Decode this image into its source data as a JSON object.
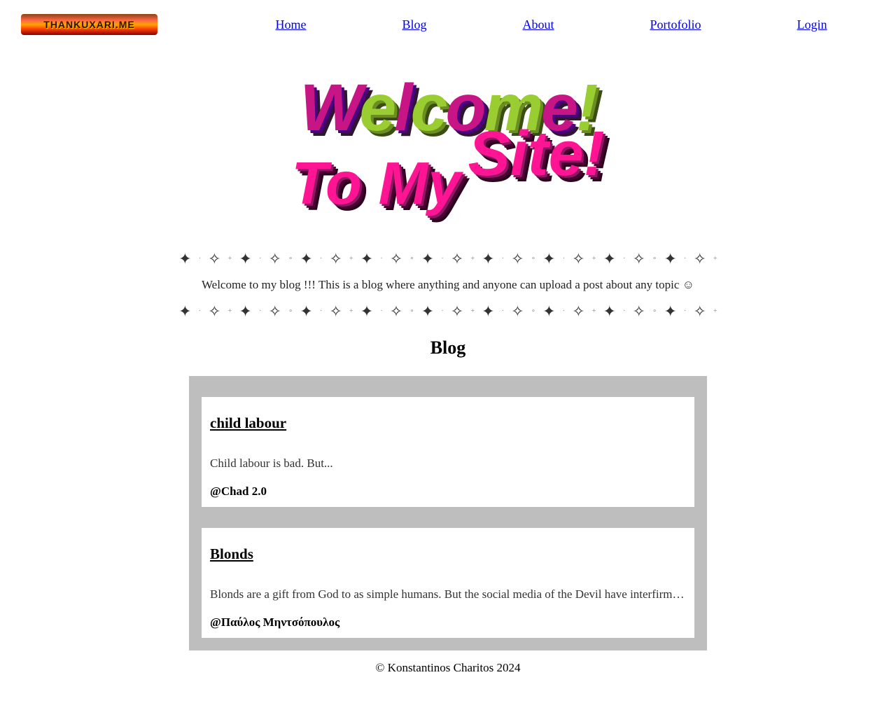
{
  "logo_text": "THANKUXARI.ME",
  "nav": {
    "home": "Home",
    "blog": "Blog",
    "about": "About",
    "portfolio": "Portofolio",
    "login": "Login"
  },
  "hero": {
    "welcome": "Welcome!",
    "tomy": "To My",
    "site": "Site!"
  },
  "intro": "Welcome to my blog !!! This is a blog where anything and anyone can upload a post about any topic ☺",
  "blog_heading": "Blog",
  "posts": [
    {
      "title": "child labour",
      "excerpt": "Child labour is bad. But...",
      "author": "@Chad 2.0"
    },
    {
      "title": "Blonds",
      "excerpt": "Blonds are a gift from God to as simple humans. But the social media of the Devil have interfirm and defiled them into creatures of sin and other things that may or may not be true",
      "author": "@Παύλος Μηντσόπουλος"
    }
  ],
  "footer": "© Konstantinos Charitos 2024"
}
